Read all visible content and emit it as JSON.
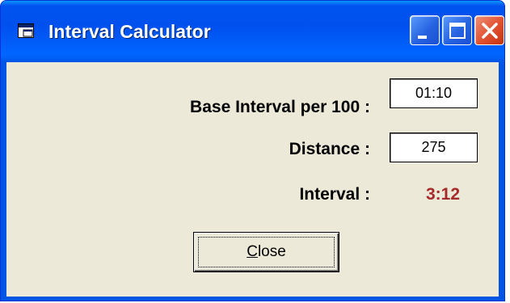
{
  "window": {
    "title": "Interval Calculator",
    "icon": "app-window-icon",
    "controls": [
      "minimize-icon",
      "maximize-icon",
      "close-icon"
    ]
  },
  "form": {
    "base_label": "Base Interval per 100 :",
    "base_value": "01:10",
    "distance_label": "Distance :",
    "distance_value": "275",
    "interval_label": "Interval :",
    "interval_result": "3:12"
  },
  "buttons": {
    "close_mnemonic": "C",
    "close_rest": "lose"
  },
  "colors": {
    "titlebar": "#0055e5",
    "client": "#ece9d8",
    "result": "#a52a2a",
    "close_button_red": "#e0502e"
  }
}
